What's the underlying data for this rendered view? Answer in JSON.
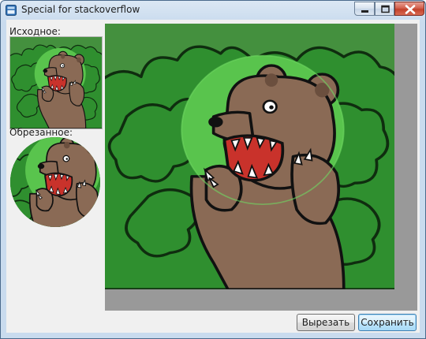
{
  "window": {
    "title": "Special for stackoverflow",
    "app_icon": "app-window-icon",
    "controls": [
      "minimize-icon",
      "maximize-icon",
      "close-icon"
    ]
  },
  "left_panel": {
    "original_label": "Исходное:",
    "cropped_label": "Обрезанное:"
  },
  "buttons": {
    "crop_label": "Вырезать",
    "save_label": "Сохранить"
  },
  "colors": {
    "bush_green": "#2f8f2f",
    "bright_green": "#59c44d",
    "bear_brown": "#8a6a55",
    "mouth_red": "#c9322b",
    "panel_gray": "#999999"
  }
}
